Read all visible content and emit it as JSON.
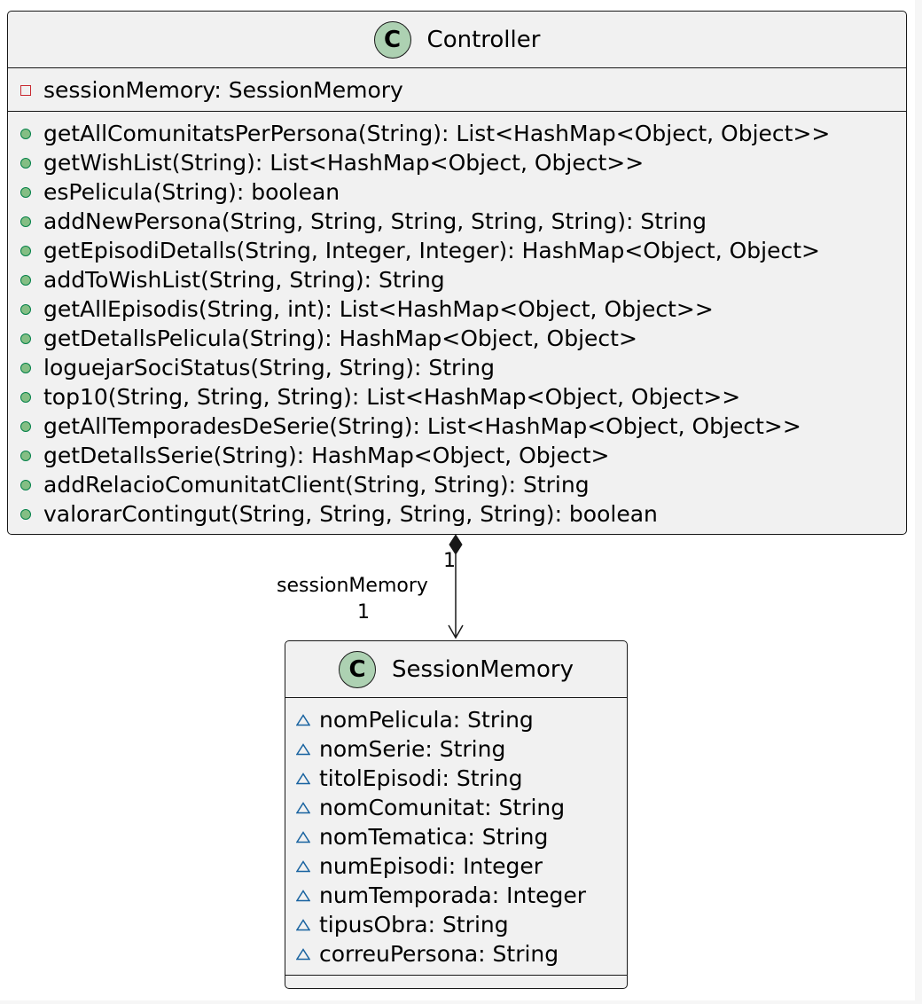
{
  "classes": {
    "controller": {
      "stereotype": "C",
      "name": "Controller",
      "fields": [
        {
          "visibility": "private",
          "text": "sessionMemory: SessionMemory"
        }
      ],
      "methods": [
        {
          "visibility": "public",
          "text": "getAllComunitatsPerPersona(String): List<HashMap<Object, Object>>"
        },
        {
          "visibility": "public",
          "text": "getWishList(String): List<HashMap<Object, Object>>"
        },
        {
          "visibility": "public",
          "text": "esPelicula(String): boolean"
        },
        {
          "visibility": "public",
          "text": "addNewPersona(String, String, String, String, String): String"
        },
        {
          "visibility": "public",
          "text": "getEpisodiDetalls(String, Integer, Integer): HashMap<Object, Object>"
        },
        {
          "visibility": "public",
          "text": "addToWishList(String, String): String"
        },
        {
          "visibility": "public",
          "text": "getAllEpisodis(String, int): List<HashMap<Object, Object>>"
        },
        {
          "visibility": "public",
          "text": "getDetallsPelicula(String): HashMap<Object, Object>"
        },
        {
          "visibility": "public",
          "text": "loguejarSociStatus(String, String): String"
        },
        {
          "visibility": "public",
          "text": "top10(String, String, String): List<HashMap<Object, Object>>"
        },
        {
          "visibility": "public",
          "text": "getAllTemporadesDeSerie(String): List<HashMap<Object, Object>>"
        },
        {
          "visibility": "public",
          "text": "getDetallsSerie(String): HashMap<Object, Object>"
        },
        {
          "visibility": "public",
          "text": "addRelacioComunitatClient(String, String): String"
        },
        {
          "visibility": "public",
          "text": "valorarContingut(String, String, String, String): boolean"
        }
      ]
    },
    "session": {
      "stereotype": "C",
      "name": "SessionMemory",
      "fields": [
        {
          "visibility": "package",
          "text": "nomPelicula: String"
        },
        {
          "visibility": "package",
          "text": "nomSerie: String"
        },
        {
          "visibility": "package",
          "text": "titolEpisodi: String"
        },
        {
          "visibility": "package",
          "text": "nomComunitat: String"
        },
        {
          "visibility": "package",
          "text": "nomTematica: String"
        },
        {
          "visibility": "package",
          "text": "numEpisodi: Integer"
        },
        {
          "visibility": "package",
          "text": "numTemporada: Integer"
        },
        {
          "visibility": "package",
          "text": "tipusObra: String"
        },
        {
          "visibility": "package",
          "text": "correuPersona: String"
        }
      ],
      "methods": []
    }
  },
  "relation": {
    "type": "composition",
    "source_multiplicity": "1",
    "role": "sessionMemory",
    "target_multiplicity": "1"
  },
  "colors": {
    "class_fill": "#f1f1f1",
    "stereotype_circle": "#add1b2",
    "border": "#181818",
    "private_marker": "#c82930",
    "public_marker": "#84be84",
    "package_marker": "#1963a0"
  }
}
